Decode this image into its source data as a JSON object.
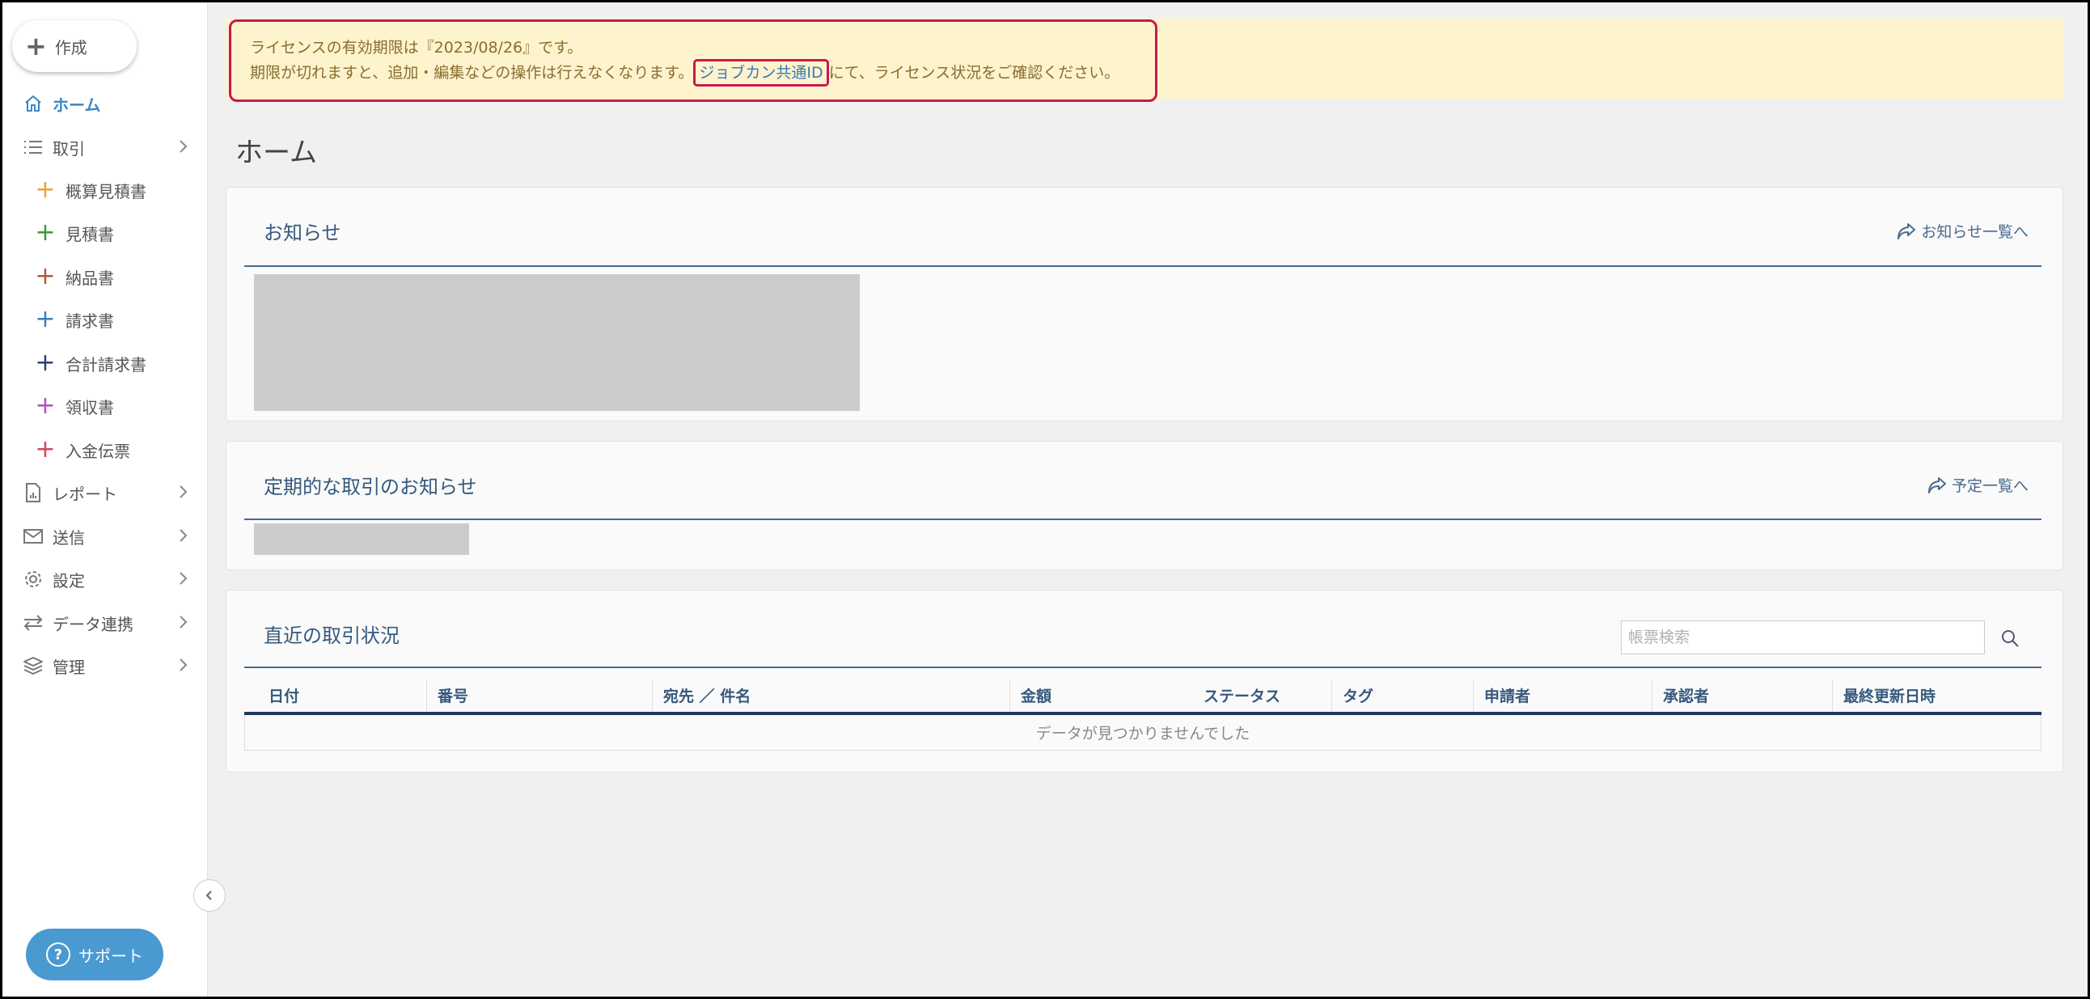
{
  "sidebar": {
    "create_label": "作成",
    "nav_items": [
      {
        "label": "ホーム",
        "icon": "home-icon"
      },
      {
        "label": "取引",
        "icon": "list-icon"
      },
      {
        "label": "レポート",
        "icon": "report-icon"
      },
      {
        "label": "送信",
        "icon": "mail-icon"
      },
      {
        "label": "設定",
        "icon": "gear-icon"
      },
      {
        "label": "データ連携",
        "icon": "sync-icon"
      },
      {
        "label": "管理",
        "icon": "layers-icon"
      }
    ],
    "sub_items": [
      {
        "label": "概算見積書",
        "color": "#e8a33a"
      },
      {
        "label": "見積書",
        "color": "#3a9a3a"
      },
      {
        "label": "納品書",
        "color": "#b05a32"
      },
      {
        "label": "請求書",
        "color": "#3a7ec6"
      },
      {
        "label": "合計請求書",
        "color": "#2c3e75"
      },
      {
        "label": "領収書",
        "color": "#b24fc0"
      },
      {
        "label": "入金伝票",
        "color": "#d0485e"
      }
    ],
    "support_label": "サポート",
    "support_icon": "question-icon",
    "collapse_icon": "chevron-left-icon"
  },
  "banner": {
    "line1": "ライセンスの有効期限は『2023/08/26』です。",
    "line2_before": "期限が切れますと、追加・編集などの操作は行えなくなります。",
    "line2_link": "ジョブカン共通ID",
    "line2_after": "にて、ライセンス状況をご確認ください。"
  },
  "page_title": "ホーム",
  "notices": {
    "title": "お知らせ",
    "link": "お知らせ一覧へ"
  },
  "recurring": {
    "title": "定期的な取引のお知らせ",
    "link": "予定一覧へ"
  },
  "recent": {
    "title": "直近の取引状況",
    "search_placeholder": "帳票検索",
    "columns": [
      "日付",
      "番号",
      "宛先 ／ 件名",
      "金額",
      "ステータス",
      "タグ",
      "申請者",
      "承認者",
      "最終更新日時"
    ],
    "empty_message": "データが見つかりませんでした"
  },
  "colors": {
    "accent": "#3a86c8",
    "banner_bg": "#fdf3cd",
    "highlight_border": "#c8194f",
    "panel_title": "#36597e"
  }
}
